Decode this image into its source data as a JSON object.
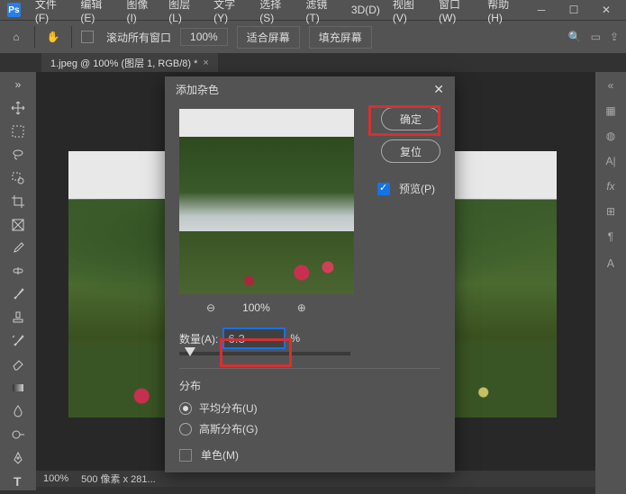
{
  "menu": {
    "file": "文件(F)",
    "edit": "编辑(E)",
    "image": "图像(I)",
    "layer": "图层(L)",
    "type": "文字(Y)",
    "select": "选择(S)",
    "filter": "滤镜(T)",
    "threeD": "3D(D)",
    "view": "视图(V)",
    "window": "窗口(W)",
    "help": "帮助(H)"
  },
  "options": {
    "scroll_all": "滚动所有窗口",
    "zoom": "100%",
    "fit_screen": "适合屏幕",
    "fill_screen": "填充屏幕"
  },
  "tab": {
    "title": "1.jpeg @ 100% (图层 1, RGB/8) *"
  },
  "status": {
    "zoom": "100%",
    "dims": "500 像素 x 281..."
  },
  "dialog": {
    "title": "添加杂色",
    "ok": "确定",
    "reset": "复位",
    "preview_label": "预览(P)",
    "zoom": "100%",
    "amount_label": "数量(A):",
    "amount_value": "6.3",
    "amount_unit": "%",
    "dist_title": "分布",
    "dist_uniform": "平均分布(U)",
    "dist_gaussian": "高斯分布(G)",
    "mono": "单色(M)"
  }
}
